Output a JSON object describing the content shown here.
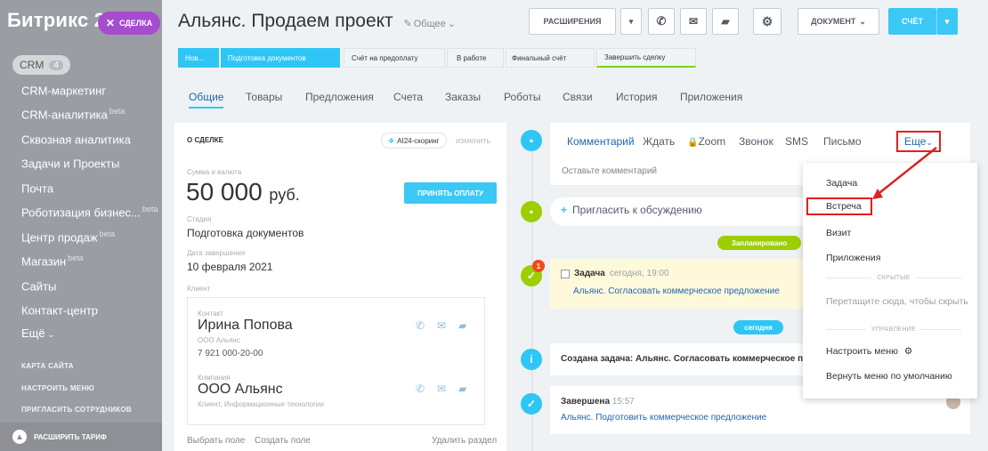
{
  "sidebar": {
    "logo": "Битрикс 24",
    "crm_label": "CRM",
    "crm_count": "4",
    "items": [
      {
        "label": "CRM-маркетинг",
        "beta": ""
      },
      {
        "label": "CRM-аналитика",
        "beta": "beta"
      },
      {
        "label": "Сквозная аналитика",
        "beta": ""
      },
      {
        "label": "Задачи и Проекты",
        "beta": ""
      },
      {
        "label": "Почта",
        "beta": ""
      },
      {
        "label": "Роботизация бизнес...",
        "beta": "beta"
      },
      {
        "label": "Центр продаж",
        "beta": "beta"
      },
      {
        "label": "Магазин",
        "beta": "beta"
      },
      {
        "label": "Сайты",
        "beta": ""
      },
      {
        "label": "Контакт-центр",
        "beta": ""
      },
      {
        "label": "Ещё",
        "beta": ""
      }
    ],
    "links": [
      "КАРТА САЙТА",
      "НАСТРОИТЬ МЕНЮ",
      "ПРИГЛАСИТЬ СОТРУДНИКОВ"
    ],
    "upgrade": "РАСШИРИТЬ ТАРИФ"
  },
  "close_tag": {
    "label": "СДЕЛКА",
    "icon": "close-icon"
  },
  "header": {
    "title": "Альянс. Продаем проект",
    "category": "Общее",
    "extensions": "РАСШИРЕНИЯ",
    "document": "ДОКУМЕНТ",
    "invoice": "СЧЁТ"
  },
  "pipeline": [
    "Нов...",
    "Подготовка документов",
    "Счёт на предоплату",
    "В работе",
    "Финальный счёт",
    "Завершить сделку"
  ],
  "tabs": [
    "Общие",
    "Товары",
    "Предложения",
    "Счета",
    "Заказы",
    "Роботы",
    "Связи",
    "История",
    "Приложения"
  ],
  "deal": {
    "section": "О СДЕЛКЕ",
    "scoring": "AI24-скоринг",
    "edit": "изменить",
    "amount_label": "Сумма и валюта",
    "amount": "50 000",
    "currency": "руб.",
    "pay_button": "ПРИНЯТЬ ОПЛАТУ",
    "stage_label": "Стадия",
    "stage": "Подготовка документов",
    "date_label": "Дата завершения",
    "date": "10 февраля 2021",
    "client_label": "Клиент",
    "contact_label": "Контакт",
    "contact_name": "Ирина Попова",
    "contact_company": "ООО Альянс",
    "contact_phone": "7 921 000-20-00",
    "company_label": "Компания",
    "company_name": "ООО Альянс",
    "company_desc": "Клиент, Информационные технологии",
    "footer_select": "Выбрать поле",
    "footer_create": "Создать поле",
    "footer_delete": "Удалить раздел"
  },
  "activity": {
    "tabs": [
      "Комментарий",
      "Ждать",
      "Zoom",
      "Звонок",
      "SMS",
      "Письмо",
      "Еще"
    ],
    "comment_placeholder": "Оставьте комментарий",
    "invite": "Пригласить к обсуждению",
    "planned_badge": "Запланировано",
    "task_title": "Задача",
    "task_time": "сегодня, 19:00",
    "task_desc": "Альянс. Согласовать коммерческое предложение",
    "task_notify": "1",
    "today_badge": "сегодня",
    "created_text": "Создана задача: Альянс. Согласовать коммерческое п",
    "done_title": "Завершена",
    "done_time": "15:57",
    "done_desc": "Альянс. Подготовить коммерческое предложение"
  },
  "dropdown": {
    "items": [
      "Задача",
      "Встреча",
      "Визит",
      "Приложения"
    ],
    "hidden_section": "СКРЫТЫЕ",
    "drag_hint": "Перетащите сюда, чтобы скрыть",
    "manage_section": "УПРАВЛЕНИЕ",
    "configure": "Настроить меню",
    "reset": "Вернуть меню по умолчанию"
  },
  "colors": {
    "accent": "#2fc6f6",
    "highlight": "#e02020",
    "sidebar": "#9a9da3"
  }
}
